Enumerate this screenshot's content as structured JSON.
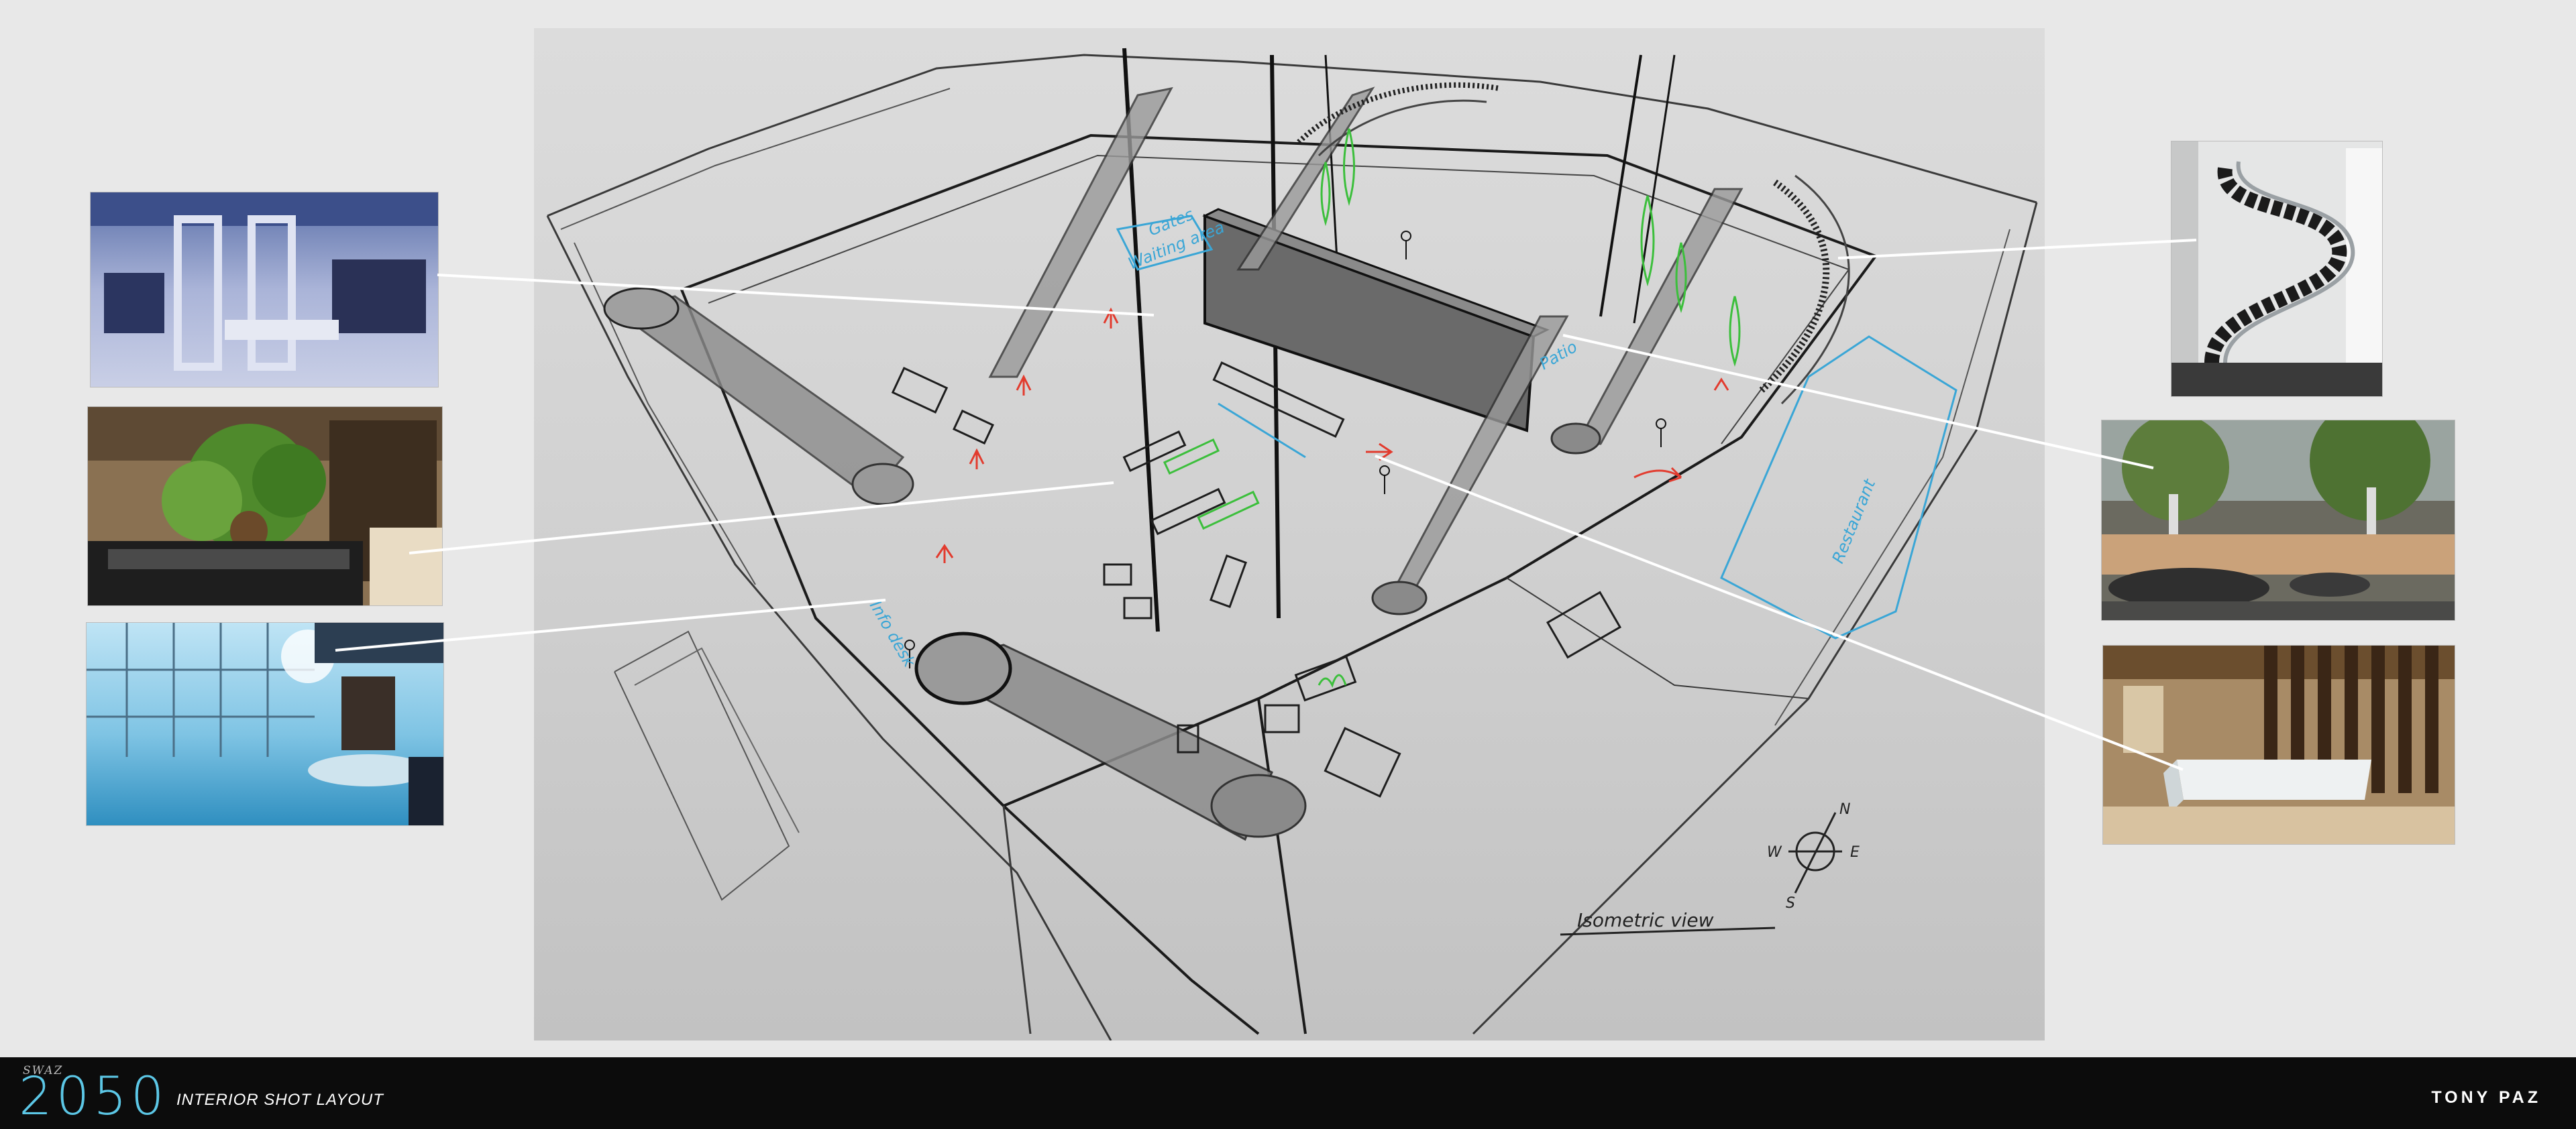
{
  "footer": {
    "logo_small": "SWAZ",
    "logo_big": "2050",
    "subtitle": "INTERIOR SHOT LAYOUT",
    "author": "TONY PAZ"
  },
  "sketch": {
    "view_label": "Isometric view",
    "compass": {
      "n": "N",
      "e": "E",
      "s": "S",
      "w": "W"
    },
    "annotations": {
      "restaurant": "Restaurant",
      "patio": "Patio",
      "gates": "Gates",
      "waiting_area": "Waiting area",
      "info_desk": "Info desk"
    }
  },
  "colors": {
    "footer_bg": "#0c0c0c",
    "logo_accent": "#5cc7e6",
    "sketch_blue": "#3aa6d6",
    "sketch_green": "#3cbf3c",
    "sketch_red": "#e23b2e"
  },
  "reference_images": [
    {
      "name": "security-checkpoint-photo",
      "subject": "security checkpoint"
    },
    {
      "name": "planter-lounge-photo",
      "subject": "tree planter lounge"
    },
    {
      "name": "glass-terminal-photo",
      "subject": "glass terminal hall"
    },
    {
      "name": "spiral-staircase-photo",
      "subject": "spiral staircase"
    },
    {
      "name": "atrium-dining-photo",
      "subject": "tree atrium dining"
    },
    {
      "name": "reception-desk-photo",
      "subject": "marble reception desk"
    }
  ]
}
